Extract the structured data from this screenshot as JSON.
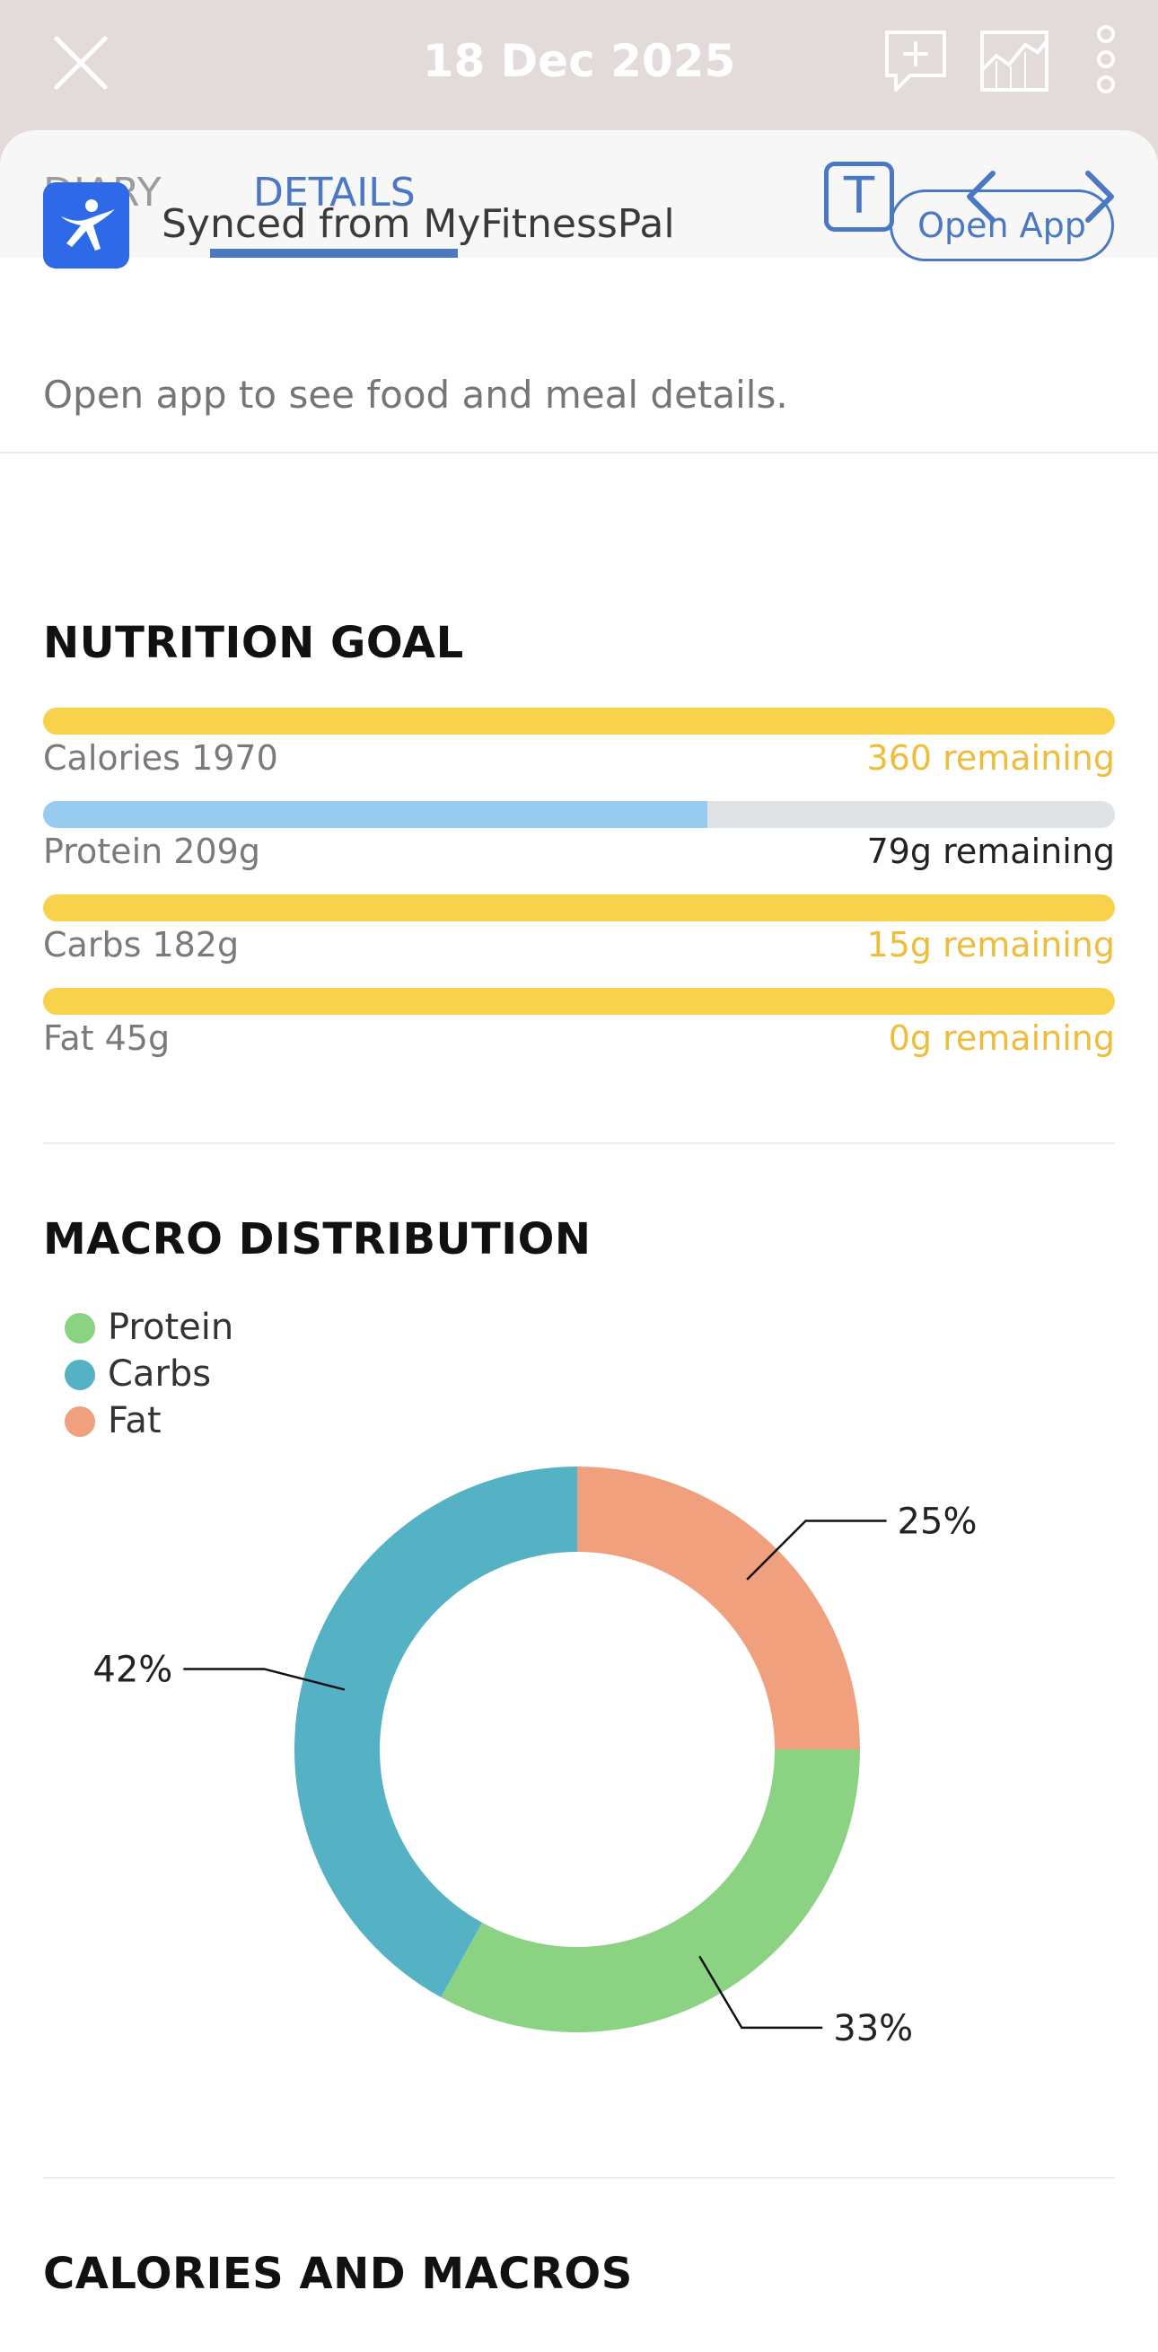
{
  "header": {
    "date": "18 Dec 2025",
    "close_icon": "close-icon",
    "add_comment_icon": "add-comment-icon",
    "chart_icon": "chart-icon",
    "more_icon": "more-vertical-icon"
  },
  "tabs": {
    "diary": "DIARY",
    "details": "DETAILS",
    "active": "details",
    "text_toggle": "T"
  },
  "sync": {
    "text": "Synced from MyFitnessPal",
    "button": "Open App",
    "hint": "Open app to see food and meal details."
  },
  "nutrition_goal": {
    "title": "NUTRITION GOAL",
    "rows": [
      {
        "label": "Calories 1970",
        "remaining": "360 remaining",
        "fill": 1.0,
        "color": "#f7d24a",
        "remaining_color": "#efbc3c"
      },
      {
        "label": "Protein 209g",
        "remaining": "79g remaining",
        "fill": 0.62,
        "color": "#97ccf0",
        "remaining_color": "#222222"
      },
      {
        "label": "Carbs 182g",
        "remaining": "15g remaining",
        "fill": 1.0,
        "color": "#f7d24a",
        "remaining_color": "#efbc3c"
      },
      {
        "label": "Fat 45g",
        "remaining": "0g remaining",
        "fill": 1.0,
        "color": "#f7d24a",
        "remaining_color": "#efbc3c"
      }
    ]
  },
  "macro": {
    "title": "MACRO DISTRIBUTION"
  },
  "chart_data": {
    "type": "pie",
    "title": "MACRO DISTRIBUTION",
    "legend": "top-left",
    "series": [
      {
        "name": "Protein",
        "value": 33,
        "label": "33%",
        "color": "#8bd283"
      },
      {
        "name": "Carbs",
        "value": 42,
        "label": "42%",
        "color": "#55b2c4"
      },
      {
        "name": "Fat",
        "value": 25,
        "label": "25%",
        "color": "#f1a07e"
      }
    ]
  },
  "calories_macros": {
    "title": "CALORIES AND MACROS"
  }
}
